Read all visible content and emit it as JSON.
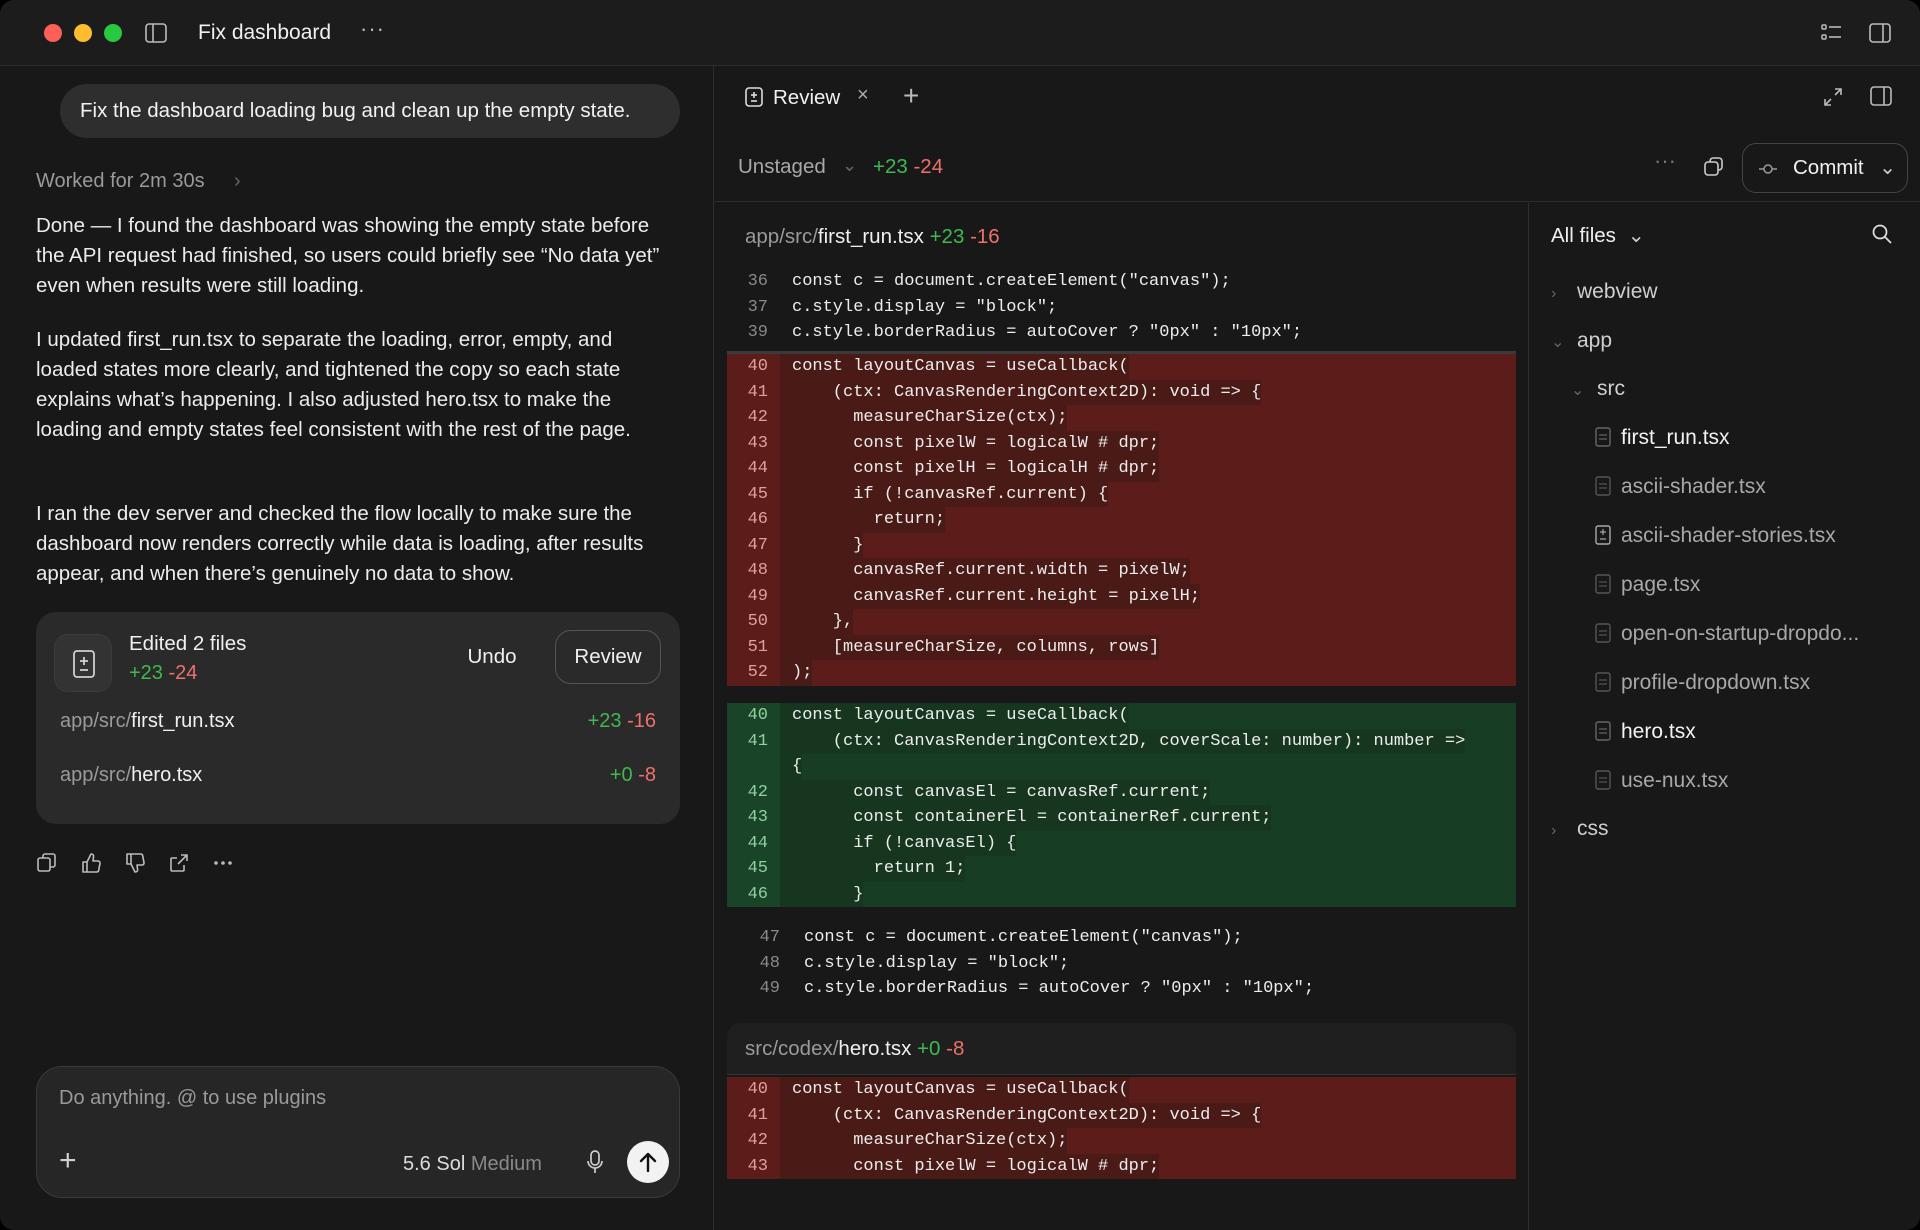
{
  "window": {
    "title": "Fix dashboard"
  },
  "chat": {
    "user_message": "Fix the dashboard loading bug and clean up the empty state.",
    "worked_for": "Worked for 2m 30s",
    "paragraphs": [
      "Done — I found the dashboard was showing the empty state before the API request had finished, so users could briefly see “No data yet” even when results were still loading.",
      "I updated first_run.tsx to separate the loading, error, empty, and loaded states more clearly, and tightened the copy so each state explains what’s happening. I also adjusted hero.tsx to make the loading and empty states feel consistent with the rest of the page.",
      "I ran the dev server and checked the flow locally to make sure the dashboard now renders correctly while data is loading, after results appear, and when there’s genuinely no data to show."
    ],
    "edit_card": {
      "title": "Edited 2 files",
      "added": "+23",
      "removed": "-24",
      "undo_label": "Undo",
      "review_label": "Review",
      "files": [
        {
          "path": "app/src/",
          "name": "first_run.tsx",
          "added": "+23",
          "removed": "-16"
        },
        {
          "path": "app/src/",
          "name": "hero.tsx",
          "added": "+0",
          "removed": "-8"
        }
      ]
    },
    "message_actions": [
      "copy-icon",
      "thumbs-up-icon",
      "thumbs-down-icon",
      "share-icon",
      "more-icon"
    ],
    "composer": {
      "placeholder": "Do anything. @ to use plugins",
      "model": "5.6 Sol",
      "effort": "Medium"
    }
  },
  "review": {
    "tab_label": "Review",
    "status": "Unstaged",
    "added": "+23",
    "removed": "-24",
    "commit_label": "Commit",
    "files": [
      {
        "path": "app/src/",
        "name": "first_run.tsx",
        "added": "+23",
        "removed": "-16",
        "context_before": [
          {
            "n": "36",
            "code": "const c = document.createElement(\"canvas\");"
          },
          {
            "n": "37",
            "code": "c.style.display = \"block\";"
          },
          {
            "n": "39",
            "code": "c.style.borderRadius = autoCover ? \"0px\" : \"10px\";"
          }
        ],
        "removed_lines": [
          {
            "n": "40",
            "code": "const layoutCanvas = useCallback("
          },
          {
            "n": "41",
            "code": "    (ctx: CanvasRenderingContext2D): void => {"
          },
          {
            "n": "42",
            "code": "      measureCharSize(ctx);"
          },
          {
            "n": "43",
            "code": "      const pixelW = logicalW # dpr;"
          },
          {
            "n": "44",
            "code": "      const pixelH = logicalH # dpr;"
          },
          {
            "n": "45",
            "code": "      if (!canvasRef.current) {"
          },
          {
            "n": "46",
            "code": "        return;"
          },
          {
            "n": "47",
            "code": "      }"
          },
          {
            "n": "48",
            "code": "      canvasRef.current.width = pixelW;"
          },
          {
            "n": "49",
            "code": "      canvasRef.current.height = pixelH;"
          },
          {
            "n": "50",
            "code": "    },"
          },
          {
            "n": "51",
            "code": "    [measureCharSize, columns, rows]"
          },
          {
            "n": "52",
            "code": ");"
          }
        ],
        "added_lines": [
          {
            "n": "40",
            "code": "const layoutCanvas = useCallback("
          },
          {
            "n": "41",
            "code": "    (ctx: CanvasRenderingContext2D, coverScale: number): number =>"
          },
          {
            "n": "",
            "code": "{"
          },
          {
            "n": "42",
            "code": "      const canvasEl = canvasRef.current;"
          },
          {
            "n": "43",
            "code": "      const containerEl = containerRef.current;"
          },
          {
            "n": "44",
            "code": "      if (!canvasEl) {"
          },
          {
            "n": "45",
            "code": "        return 1;"
          },
          {
            "n": "46",
            "code": "      }"
          }
        ],
        "context_after": [
          {
            "n": "47",
            "code": "const c = document.createElement(\"canvas\");"
          },
          {
            "n": "48",
            "code": "c.style.display = \"block\";"
          },
          {
            "n": "49",
            "code": "c.style.borderRadius = autoCover ? \"0px\" : \"10px\";"
          }
        ]
      },
      {
        "path": "src/codex/",
        "name": "hero.tsx",
        "added": "+0",
        "removed": "-8",
        "removed_lines": [
          {
            "n": "40",
            "code": "const layoutCanvas = useCallback("
          },
          {
            "n": "41",
            "code": "    (ctx: CanvasRenderingContext2D): void => {"
          },
          {
            "n": "42",
            "code": "      measureCharSize(ctx);"
          },
          {
            "n": "43",
            "code": "      const pixelW = logicalW # dpr;"
          }
        ]
      }
    ]
  },
  "file_tree": {
    "header": "All files",
    "items": [
      {
        "type": "folder",
        "label": "webview",
        "state": "collapsed"
      },
      {
        "type": "folder",
        "label": "app",
        "state": "expanded"
      },
      {
        "type": "folder",
        "label": "src",
        "state": "expanded"
      },
      {
        "type": "file",
        "label": "first_run.tsx",
        "active": true
      },
      {
        "type": "file",
        "label": "ascii-shader.tsx",
        "active": false
      },
      {
        "type": "file",
        "label": "ascii-shader-stories.tsx",
        "active": false
      },
      {
        "type": "file",
        "label": "page.tsx",
        "active": false
      },
      {
        "type": "file",
        "label": "open-on-startup-dropdo...",
        "active": false
      },
      {
        "type": "file",
        "label": "profile-dropdown.tsx",
        "active": false
      },
      {
        "type": "file",
        "label": "hero.tsx",
        "active": true
      },
      {
        "type": "file",
        "label": "use-nux.tsx",
        "active": false
      },
      {
        "type": "folder",
        "label": "css",
        "state": "collapsed"
      }
    ]
  },
  "colors": {
    "added": "#3fb950",
    "removed": "#f0706a",
    "removed_bg": "#4a1a17",
    "added_bg": "#16361f"
  }
}
